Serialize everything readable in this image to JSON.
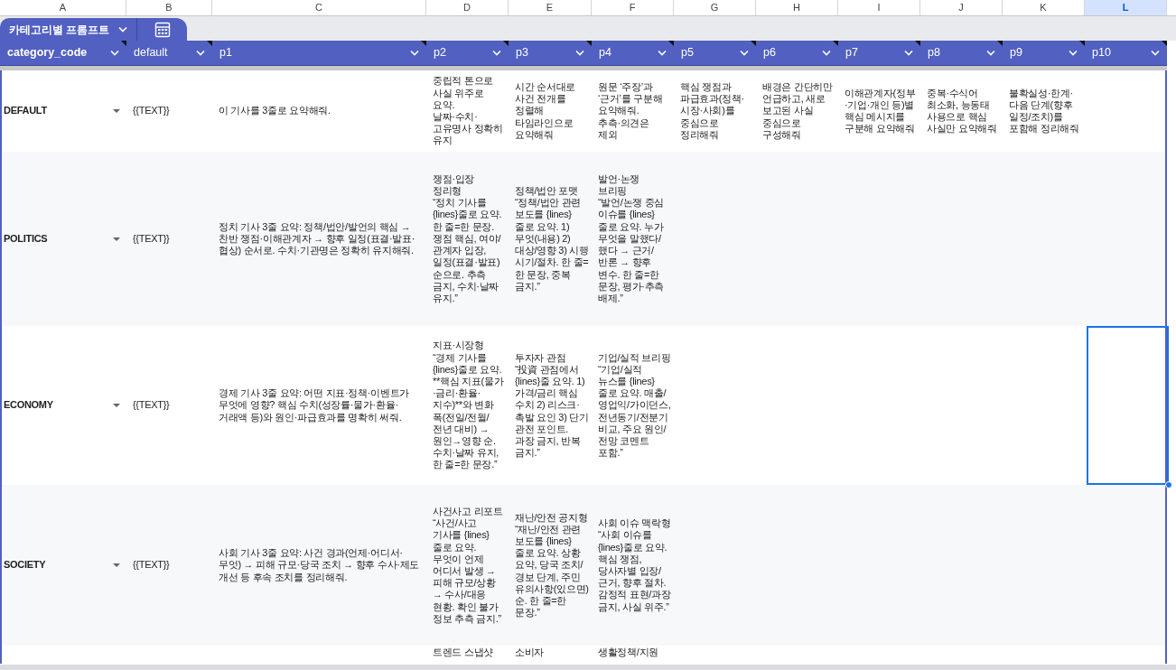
{
  "sheet_columns": [
    {
      "letter": "A",
      "selected": false
    },
    {
      "letter": "B",
      "selected": false
    },
    {
      "letter": "C",
      "selected": false
    },
    {
      "letter": "D",
      "selected": false
    },
    {
      "letter": "E",
      "selected": false
    },
    {
      "letter": "F",
      "selected": false
    },
    {
      "letter": "G",
      "selected": false
    },
    {
      "letter": "H",
      "selected": false
    },
    {
      "letter": "I",
      "selected": false
    },
    {
      "letter": "J",
      "selected": false
    },
    {
      "letter": "K",
      "selected": false
    },
    {
      "letter": "L",
      "selected": true
    }
  ],
  "table": {
    "name": "카테고리별 프롬프트",
    "columns": [
      "category_code",
      "default",
      "p1",
      "p2",
      "p3",
      "p4",
      "p5",
      "p6",
      "p7",
      "p8",
      "p9",
      "p10"
    ],
    "rows": [
      {
        "selected": false,
        "cells": [
          "DEFAULT",
          "{{TEXT}}",
          "이 기사를 3줄로 요약해줘.",
          "중립적 톤으로 사실 위주로 요약.\n날짜·수치·고유명사 정확히 유지",
          "시간 순서대로 사건 전개를 정렬해 타임라인으로 요약해줘",
          "원문 ‘주장’과 ‘근거’를 구분해 요약해줘.\n추측·의견은 제외",
          "핵심 쟁점과 파급효과(정책·시장·사회)를 중심으로 정리해줘",
          "배경은 간단히만 언급하고, 새로 보고된 사실 중심으로 구성해줘",
          "이해관계자(정부·기업·개인 등)별 핵심 메시지를 구분해 요약해줘",
          "중복·수식어 최소화, 능동태 사용으로 핵심 사실만 요약해줘",
          "불확실성·한계·다음 단계(향후 일정/조치)를 포함해 정리해줘",
          null
        ]
      },
      {
        "selected": false,
        "cells": [
          "POLITICS",
          "{{TEXT}}",
          "정치 기사 3줄 요약: 정책/법안/발언의 핵심 → 찬반 쟁점·이해관계자 → 향후 일정(표결·발표·협상) 순서로. 수치·기관명은 정확히 유지해줘.",
          "쟁점·입장 정리형\n“정치 기사를 {lines}줄로 요약. 한 줄=한 문장. 쟁점 핵심, 여야/관계자 입장, 일정(표결·발표) 순으로. 추측 금지, 수치·날짜 유지.”",
          "정책/법안 포맷\n“정책/법안 관련 보도를 {lines}줄로 요약. 1) 무엇(내용) 2) 대상/영향 3) 시행 시기/절차. 한 줄=한 문장, 중복 금지.”",
          "발언·논쟁 브리핑\n“발언/논쟁 중심 이슈를 {lines}줄로 요약. 누가 무엇을 말했다/했다 → 근거/반론 → 향후 변수. 한 줄=한 문장, 평가·추측 배제.”",
          null,
          null,
          null,
          null,
          null,
          null
        ]
      },
      {
        "selected": true,
        "cells": [
          "ECONOMY",
          "{{TEXT}}",
          "경제 기사 3줄 요약: 어떤 지표·정책·이벤트가 무엇에 영향? 핵심 수치(성장률·물가·환율·거래액 등)와 원인·파급효과를 명확히 써줘.",
          "지표·시장형\n“경제 기사를 {lines}줄로 요약. **핵심 지표(물가·금리·환율·지수)**와 변화 폭(전일/전월/전년 대비) → 원인→영향 순. 수치·날짜 유지, 한 줄=한 문장.”",
          "투자자 관점\n“投資 관점에서 {lines}줄 요약. 1) 가격/금리 핵심 수치 2) 리스크·촉발 요인 3) 단기 관전 포인트. 과장 금지, 반복 금지.”",
          "기업/실적 브리핑\n“기업/실적 뉴스를 {lines}줄로 요약. 매출/영업익/가이던스, 전년동기/전분기 비교, 주요 원인/전망 코멘트 포함.”",
          null,
          null,
          null,
          null,
          null,
          null
        ]
      },
      {
        "selected": false,
        "cells": [
          "SOCIETY",
          "{{TEXT}}",
          "사회 기사 3줄 요약: 사건 경과(언제·어디서·무엇) → 피해 규모·당국 조치 → 향후 수사·제도 개선 등 후속 조치를 정리해줘.",
          "사건사고 리포트\n“사건/사고 기사를 {lines}줄로 요약. 무엇이 언제 어디서 발생 → 피해 규모/상황 → 수사/대응 현황. 확인 불가 정보 추측 금지.”",
          "재난/안전 공지형\n“재난/안전 관련 보도를 {lines}줄로 요약. 상황 요약, 당국 조치/경보 단계, 주민 유의사항(있으면) 순. 한 줄=한 문장.”",
          "사회 이슈 맥락형\n“사회 이슈를 {lines}줄로 요약. 핵심 쟁점, 당사자별 입장/근거, 향후 절차. 감정적 표현/과장 금지, 사실 위주.”",
          null,
          null,
          null,
          null,
          null,
          null
        ]
      },
      {
        "selected": false,
        "cells": [
          null,
          null,
          null,
          "트렌드 스냅샷",
          "소비자",
          "생활정책/지원",
          null,
          null,
          null,
          null,
          null,
          null
        ]
      }
    ]
  }
}
